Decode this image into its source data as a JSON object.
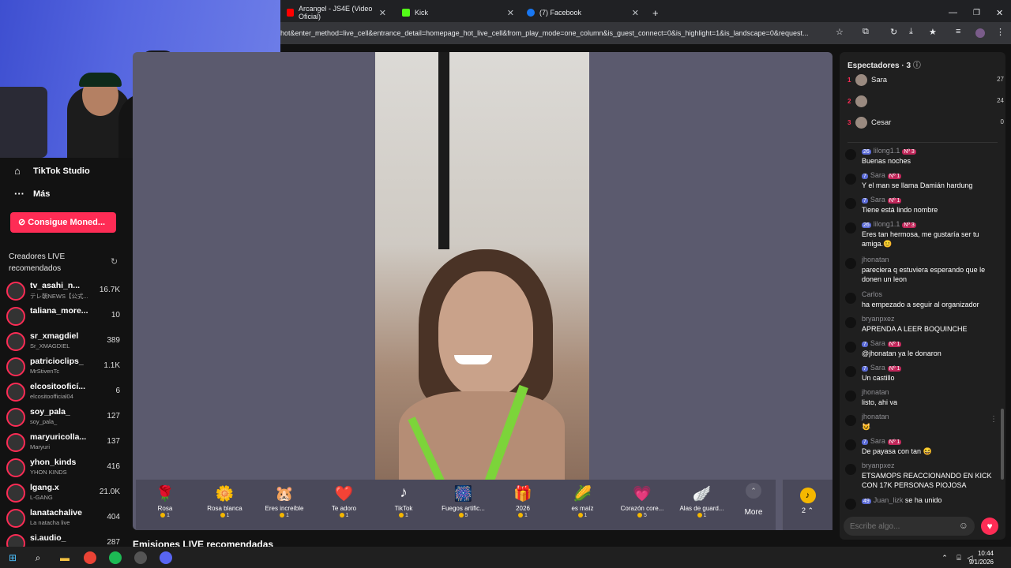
{
  "browser": {
    "tabs": [
      {
        "title": "Arcangel - JS4E (Video Oficial)",
        "icon": "youtube-icon"
      },
      {
        "title": "Kick",
        "icon": "kick-icon"
      },
      {
        "title": "(7) Facebook",
        "icon": "facebook-icon"
      }
    ],
    "new_tab": "+",
    "url": "hot&enter_method=live_cell&entrance_detail=homepage_hot_live_cell&from_play_mode=one_column&is_guest_connect=0&is_highlight=1&is_landscape=0&request..."
  },
  "sidebar": {
    "studio_label": "TikTok Studio",
    "more_label": "Más",
    "coins_button": "Consigue Moned...",
    "recommended_title": "Creadores LIVE recomendados",
    "creators": [
      {
        "name": "tv_asahi_n...",
        "sub": "テレ朝NEWS【公式...",
        "count": "16.7K"
      },
      {
        "name": "taliana_more...",
        "sub": "",
        "count": "10"
      },
      {
        "name": "sr_xmagdiel",
        "sub": "Sr_XMAGDIEL",
        "count": "389"
      },
      {
        "name": "patricioclips_",
        "sub": "MrStivenTc",
        "count": "1.1K"
      },
      {
        "name": "elcositooficí...",
        "sub": "elcositoofficial04",
        "count": "6"
      },
      {
        "name": "soy_pala_",
        "sub": "soy_pala_",
        "count": "127"
      },
      {
        "name": "maryuricolla...",
        "sub": "Maryuri",
        "count": "137"
      },
      {
        "name": "yhon_kinds",
        "sub": "YHON KINDS",
        "count": "416"
      },
      {
        "name": "lgang.x",
        "sub": "L-GANG",
        "count": "21.0K"
      },
      {
        "name": "lanatachalive",
        "sub": "La natacha live",
        "count": "404"
      },
      {
        "name": "si.audio_",
        "sub": "",
        "count": "287"
      }
    ]
  },
  "gifts": [
    {
      "name": "Rosa",
      "price": "1",
      "icon": "🌹"
    },
    {
      "name": "Rosa blanca",
      "price": "1",
      "icon": "🌼"
    },
    {
      "name": "Eres increíble",
      "price": "1",
      "icon": "🐹"
    },
    {
      "name": "Te adoro",
      "price": "1",
      "icon": "❤️"
    },
    {
      "name": "TikTok",
      "price": "1",
      "icon": "♪"
    },
    {
      "name": "Fuegos artific...",
      "price": "5",
      "icon": "🎆"
    },
    {
      "name": "2026",
      "price": "1",
      "icon": "🎁"
    },
    {
      "name": "es maíz",
      "price": "1",
      "icon": "🌽"
    },
    {
      "name": "Corazón core...",
      "price": "5",
      "icon": "💗"
    },
    {
      "name": "Alas de guard...",
      "price": "1",
      "icon": "🪽"
    }
  ],
  "more_label": "More",
  "coins_count": "2",
  "recommended_section": "Emisiones LIVE recomendadas",
  "panel": {
    "title": "Espectadores · 3",
    "spectators": [
      {
        "rank": "1",
        "name": "Sara",
        "score": "27"
      },
      {
        "rank": "2",
        "name": "",
        "score": "24"
      },
      {
        "rank": "3",
        "name": "Cesar",
        "score": "0"
      }
    ],
    "messages": [
      {
        "badge": "26",
        "user": "lilong1.1",
        "badge2": "Nº 3",
        "text": "Buenas noches"
      },
      {
        "badge": "7",
        "user": "Sara",
        "badge2": "Nº 1",
        "text": "Y el man se llama Damián hardung"
      },
      {
        "badge": "7",
        "user": "Sara",
        "badge2": "Nº 1",
        "text": "Tiene está lindo nombre"
      },
      {
        "badge": "26",
        "user": "lilong1.1",
        "badge2": "Nº 3",
        "text": "Eres tan hermosa, me gustaría ser tu amiga.😊"
      },
      {
        "badge": "",
        "user": "jhonatan",
        "badge2": "",
        "text": "pareciera q estuviera esperando que le donen un leon"
      },
      {
        "badge": "",
        "user": "Carlos",
        "badge2": "",
        "text": "ha empezado a seguir al organizador"
      },
      {
        "badge": "",
        "user": "bryanpxez",
        "badge2": "",
        "text": "APRENDA A LEER BOQUINCHE"
      },
      {
        "badge": "7",
        "user": "Sara",
        "badge2": "Nº 1",
        "text": "@jhonatan ya le donaron"
      },
      {
        "badge": "7",
        "user": "Sara",
        "badge2": "Nº 1",
        "text": "Un castillo"
      },
      {
        "badge": "",
        "user": "jhonatan",
        "badge2": "",
        "text": "listo, ahi va"
      },
      {
        "badge": "",
        "user": "jhonatan",
        "badge2": "",
        "text": "😺"
      },
      {
        "badge": "7",
        "user": "Sara",
        "badge2": "Nº 1",
        "text": "De payasa con tan 😆"
      },
      {
        "badge": "",
        "user": "bryanpxez",
        "badge2": "",
        "text": "ETSAMOPS REACCIONANDO EN KICK CON 17K PERSONAS PIOJOSA"
      },
      {
        "badge": "49",
        "user": "Juan_lizk",
        "badge2": "",
        "text": "se ha unido"
      }
    ],
    "input_placeholder": "Escribe algo..."
  },
  "taskbar": {
    "time": "10:44",
    "date": "9/1/2026"
  }
}
